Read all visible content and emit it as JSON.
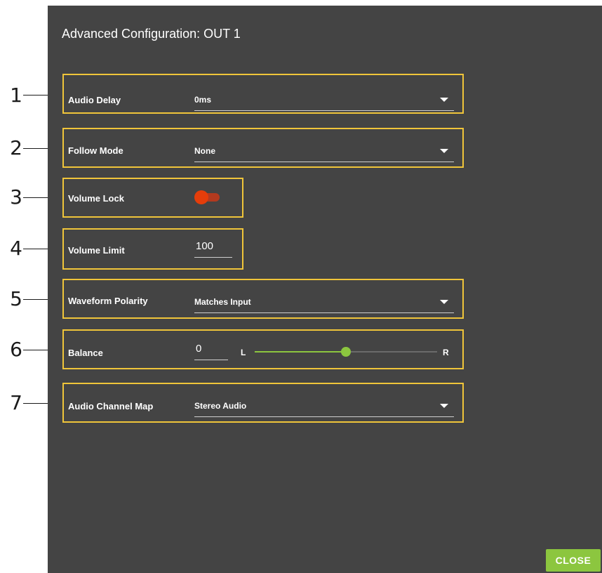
{
  "dialog": {
    "title": "Advanced Configuration: OUT 1",
    "close_label": "CLOSE"
  },
  "callouts": [
    "1",
    "2",
    "3",
    "4",
    "5",
    "6",
    "7"
  ],
  "settings": {
    "audio_delay": {
      "label": "Audio Delay",
      "value": "0ms"
    },
    "follow_mode": {
      "label": "Follow Mode",
      "value": "None"
    },
    "volume_lock": {
      "label": "Volume Lock",
      "on": true
    },
    "volume_limit": {
      "label": "Volume Limit",
      "value": "100"
    },
    "waveform_polarity": {
      "label": "Waveform Polarity",
      "value": "Matches Input"
    },
    "balance": {
      "label": "Balance",
      "value": "0",
      "left_label": "L",
      "right_label": "R",
      "position": 0.5
    },
    "audio_channel_map": {
      "label": "Audio Channel Map",
      "value": "Stereo Audio"
    }
  },
  "colors": {
    "dialog_bg": "#444444",
    "highlight_border": "#f0c53a",
    "accent_green": "#8cc63f",
    "toggle_on": "#e53d0a"
  },
  "icons": {
    "dropdown": "caret-down-icon"
  }
}
